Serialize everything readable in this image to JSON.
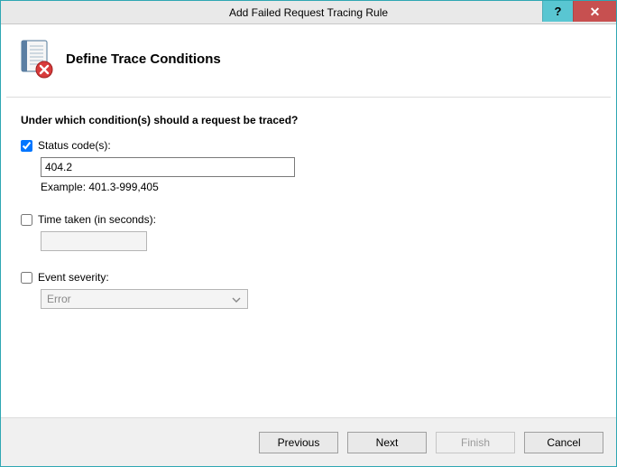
{
  "window": {
    "title": "Add Failed Request Tracing Rule"
  },
  "header": {
    "title": "Define Trace Conditions"
  },
  "content": {
    "prompt": "Under which condition(s) should a request be traced?",
    "status_codes": {
      "label": "Status code(s):",
      "checked": true,
      "value": "404.2",
      "example": "Example: 401.3-999,405"
    },
    "time_taken": {
      "label": "Time taken (in seconds):",
      "checked": false,
      "value": ""
    },
    "event_severity": {
      "label": "Event severity:",
      "checked": false,
      "selected": "Error"
    }
  },
  "footer": {
    "previous": "Previous",
    "next": "Next",
    "finish": "Finish",
    "cancel": "Cancel"
  }
}
